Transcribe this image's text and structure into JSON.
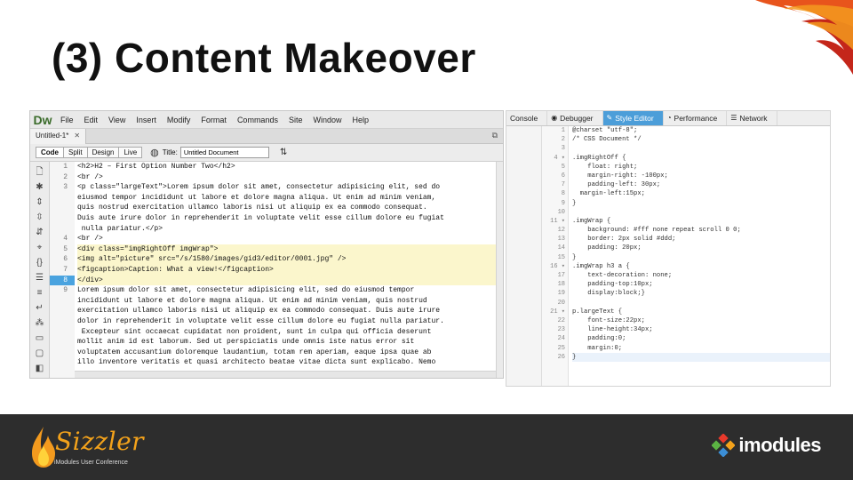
{
  "slide": {
    "title": "(3) Content Makeover"
  },
  "dreamweaver": {
    "logo": "Dw",
    "menu": [
      "File",
      "Edit",
      "View",
      "Insert",
      "Modify",
      "Format",
      "Commands",
      "Site",
      "Window",
      "Help"
    ],
    "doc_tab": "Untitled-1*",
    "view_buttons": [
      "Code",
      "Split",
      "Design",
      "Live"
    ],
    "title_label": "Title:",
    "title_value": "Untitled Document",
    "line_numbers": [
      "1",
      "2",
      "3",
      "",
      "",
      "",
      "",
      "4",
      "5",
      "6",
      "7",
      "8",
      "9",
      "",
      "",
      "",
      "",
      "",
      "",
      "",
      ""
    ],
    "highlighted_line": "8",
    "code_lines": [
      "<h2>H2 – First Option Number Two</h2>",
      "<br />",
      "<p class=\"largeText\">Lorem ipsum dolor sit amet, consectetur adipisicing elit, sed do",
      "eiusmod tempor incididunt ut labore et dolore magna aliqua. Ut enim ad minim veniam,",
      "quis nostrud exercitation ullamco laboris nisi ut aliquip ex ea commodo consequat.",
      "Duis aute irure dolor in reprehenderit in voluptate velit esse cillum dolore eu fugiat",
      " nulla pariatur.</p>",
      "<br />",
      "<div class=\"imgRightOff imgWrap\">",
      "<img alt=\"picture\" src=\"/s/1580/images/gid3/editor/0001.jpg\" />",
      "<figcaption>Caption: What a view!</figcaption>",
      "</div>",
      "Lorem ipsum dolor sit amet, consectetur adipisicing elit, sed do eiusmod tempor",
      "incididunt ut labore et dolore magna aliqua. Ut enim ad minim veniam, quis nostrud",
      "exercitation ullamco laboris nisi ut aliquip ex ea commodo consequat. Duis aute irure",
      "dolor in reprehenderit in voluptate velit esse cillum dolore eu fugiat nulla pariatur.",
      " Excepteur sint occaecat cupidatat non proident, sunt in culpa qui officia deserunt",
      "mollit anim id est laborum. Sed ut perspiciatis unde omnis iste natus error sit",
      "voluptatem accusantium doloremque laudantium, totam rem aperiam, eaque ipsa quae ab",
      "illo inventore veritatis et quasi architecto beatae vitae dicta sunt explicabo. Nemo"
    ],
    "highlighted_code_lines": [
      8,
      9,
      10,
      11
    ]
  },
  "style_editor": {
    "tabs": [
      {
        "label": "Console",
        "icon": ""
      },
      {
        "label": "Debugger",
        "icon": "◉"
      },
      {
        "label": "Style Editor",
        "icon": "✎"
      },
      {
        "label": "Performance",
        "icon": "◔"
      },
      {
        "label": "Network",
        "icon": "☰"
      }
    ],
    "active_tab": "Style Editor",
    "line_numbers": [
      "1",
      "2",
      "3",
      "4 ▾",
      "5",
      "6",
      "7",
      "8",
      "9",
      "10",
      "11 ▾",
      "12",
      "13",
      "14",
      "15",
      "16 ▾",
      "17",
      "18",
      "19",
      "20",
      "21 ▾",
      "22",
      "23",
      "24",
      "25",
      "26"
    ],
    "css_lines": [
      "@charset \"utf-8\";",
      "/* CSS Document */",
      "",
      ".imgRightOff {",
      "    float: right;",
      "    margin-right: -100px;",
      "    padding-left: 30px;",
      "  margin-left:15px;",
      "}",
      "",
      ".imgWrap {",
      "    background: #fff none repeat scroll 0 0;",
      "    border: 2px solid #ddd;",
      "    padding: 20px;",
      "}",
      ".imgWrap h3 a {",
      "    text-decoration: none;",
      "    padding-top:10px;",
      "    display:block;}",
      "",
      "p.largeText {",
      "    font-size:22px;",
      "    line-height:34px;",
      "    padding:0;",
      "    margin:0;",
      "}"
    ]
  },
  "footer": {
    "brand_left": "Sizzler",
    "brand_left_sub": "iModules User Conference",
    "brand_right": "imodules"
  },
  "colors": {
    "accent_blue": "#4c9ed9",
    "highlight_yellow": "#fbf6cc",
    "footer_bg": "#2d2d2d",
    "sizzler_orange": "#f3a21b"
  }
}
